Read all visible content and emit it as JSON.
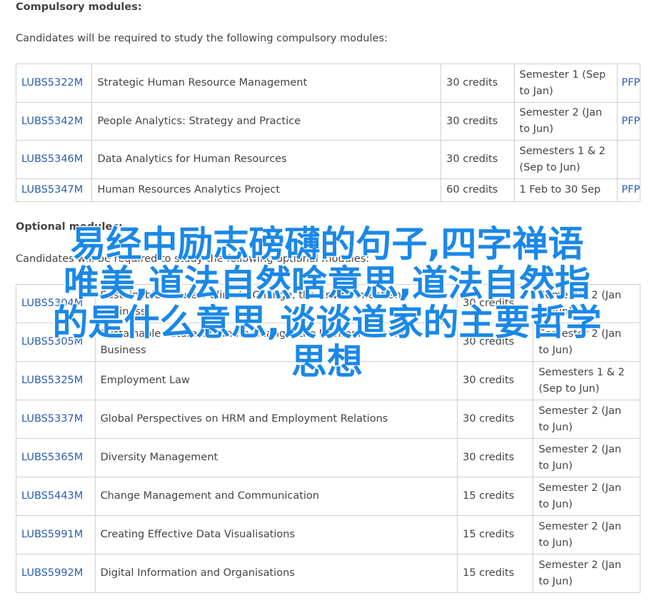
{
  "compulsory": {
    "title": "Compulsory modules:",
    "intro": "Candidates will be required to study the following compulsory modules:",
    "rows": [
      {
        "code": "LUBS5322M",
        "title": "Strategic Human Resource Management",
        "credits": "30 credits",
        "semester": "Semester 1 (Sep to Jan)",
        "pfp": "PFP"
      },
      {
        "code": "LUBS5342M",
        "title": "People Analytics: Strategy and Practice",
        "credits": "30 credits",
        "semester": "Semester 2 (Jan to Jun)",
        "pfp": "PFP"
      },
      {
        "code": "LUBS5346M",
        "title": "Data Analytics for Human Resources",
        "credits": "30 credits",
        "semester": "Semesters 1 & 2 (Sep to Jun)",
        "pfp": ""
      },
      {
        "code": "LUBS5347M",
        "title": "Human Resources Analytics Project",
        "credits": "60 credits",
        "semester": "1 Feb to 30 Sep",
        "pfp": "PFP"
      }
    ]
  },
  "optional": {
    "title": "Optional modules:",
    "intro": "Candidates will be required to study the following optional modules:",
    "rows": [
      {
        "code": "LUBS5304M",
        "title": "Sustainable Futures: Climate Change, the Environment and Business",
        "credits": "30 credits",
        "semester": "Semester 2 (Jan to Jun)"
      },
      {
        "code": "LUBS5305M",
        "title": "Sustainable Futures: Climate Change, the Environment and Business",
        "credits": "30 credits",
        "semester": "Semester 2 (Jan to Jun)"
      },
      {
        "code": "LUBS5325M",
        "title": "Employment Law",
        "credits": "30 credits",
        "semester": "Semesters 1 & 2 (Sep to Jun)"
      },
      {
        "code": "LUBS5337M",
        "title": "Global Perspectives on HRM and Employment Relations",
        "credits": "30 credits",
        "semester": "Semester 2 (Jan to Jun)"
      },
      {
        "code": "LUBS5365M",
        "title": "Diversity Management",
        "credits": "30 credits",
        "semester": "Semester 2 (Jan to Jun)"
      },
      {
        "code": "LUBS5443M",
        "title": "Change Management and Communication",
        "credits": "15 credits",
        "semester": "Semester 2 (Jan to Jun)"
      },
      {
        "code": "LUBS5991M",
        "title": "Creating Effective Data Visualisations",
        "credits": "15 credits",
        "semester": "Semester 2 (Jan to Jun)"
      },
      {
        "code": "LUBS5992M",
        "title": "Digital Information and Organisations",
        "credits": "15 credits",
        "semester": "Semester 2 (Jan to Jun)"
      }
    ]
  },
  "overlay": {
    "lines": [
      "易经中励志磅礴的句子,四字禅语",
      "唯美,道法自然啥意思,道法自然指",
      "的是什么意思,谈谈道家的主要哲学",
      "思想"
    ]
  },
  "colors": {
    "link": "#2a5db0",
    "text": "#444444",
    "border": "#d0d0d0",
    "overlay": "#1a88e8"
  }
}
